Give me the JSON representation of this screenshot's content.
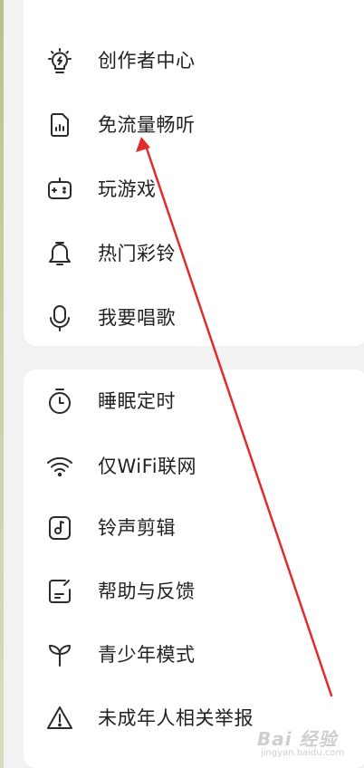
{
  "menu": {
    "group1": [
      {
        "label": "创作者中心",
        "icon": "lightbulb-icon"
      },
      {
        "label": "免流量畅听",
        "icon": "sim-card-icon"
      },
      {
        "label": "玩游戏",
        "icon": "gamepad-icon"
      },
      {
        "label": "热门彩铃",
        "icon": "bell-icon"
      },
      {
        "label": "我要唱歌",
        "icon": "microphone-icon"
      }
    ],
    "group2": [
      {
        "label": "睡眠定时",
        "icon": "timer-icon"
      },
      {
        "label": "仅WiFi联网",
        "icon": "wifi-icon"
      },
      {
        "label": "铃声剪辑",
        "icon": "music-note-icon"
      },
      {
        "label": "帮助与反馈",
        "icon": "feedback-icon"
      },
      {
        "label": "青少年模式",
        "icon": "sprout-icon"
      },
      {
        "label": "未成年人相关举报",
        "icon": "warning-icon"
      }
    ]
  },
  "annotation": {
    "color": "#e02c2c"
  },
  "watermark": {
    "text": "Bai 经验",
    "sub": "jingyan.baidu.com"
  },
  "colors": {
    "background": "#f2f2f2",
    "card": "#ffffff",
    "text": "#222222",
    "icon": "#2b2b2b"
  }
}
